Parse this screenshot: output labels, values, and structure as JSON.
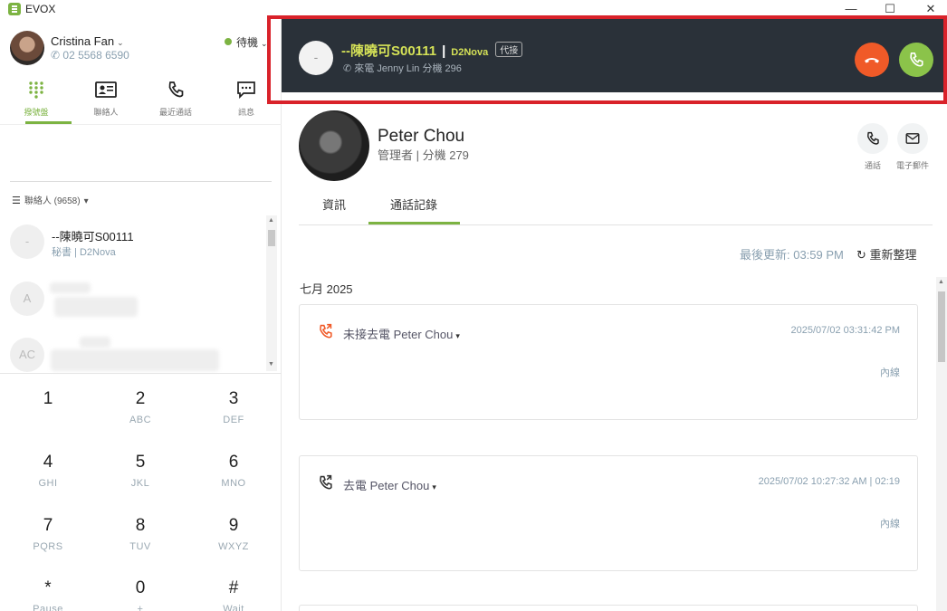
{
  "window": {
    "title": "EVOX",
    "minimize": "—",
    "maximize": "☐",
    "close": "✕"
  },
  "user": {
    "name": "Cristina Fan",
    "phone": "02 5568 6590",
    "status": "待機",
    "status_color": "#7cb342"
  },
  "nav": {
    "items": [
      {
        "label": "撥號盤",
        "icon": "dialpad-icon"
      },
      {
        "label": "聯絡人",
        "icon": "contact-card-icon"
      },
      {
        "label": "最近通話",
        "icon": "phone-icon"
      },
      {
        "label": "訊息",
        "icon": "message-icon"
      }
    ]
  },
  "contacts": {
    "header": "聯絡人 (9658)",
    "items": [
      {
        "avatar": "-",
        "name": "--陳曉可S00111",
        "sub": "秘書 | D2Nova"
      },
      {
        "avatar": "A",
        "name": "",
        "sub": ""
      },
      {
        "avatar": "AC",
        "name": "",
        "sub": ""
      }
    ]
  },
  "dialpad": [
    {
      "digit": "1",
      "letters": ""
    },
    {
      "digit": "2",
      "letters": "ABC"
    },
    {
      "digit": "3",
      "letters": "DEF"
    },
    {
      "digit": "4",
      "letters": "GHI"
    },
    {
      "digit": "5",
      "letters": "JKL"
    },
    {
      "digit": "6",
      "letters": "MNO"
    },
    {
      "digit": "7",
      "letters": "PQRS"
    },
    {
      "digit": "8",
      "letters": "TUV"
    },
    {
      "digit": "9",
      "letters": "WXYZ"
    },
    {
      "digit": "*",
      "letters": "Pause"
    },
    {
      "digit": "0",
      "letters": "+"
    },
    {
      "digit": "#",
      "letters": "Wait"
    }
  ],
  "incoming_call": {
    "avatar": "-",
    "caller": "--陳曉可S00111",
    "separator": "|",
    "company": "D2Nova",
    "tag": "代接",
    "subtitle": "來電 Jenny Lin 分機 296",
    "accent_color": "#d4e157",
    "hangup_color": "#f05a28",
    "answer_color": "#8bc34a"
  },
  "contact_detail": {
    "name": "Peter Chou",
    "role": "管理者 | 分機 279",
    "actions": {
      "call": "通話",
      "email": "電子郵件"
    },
    "tabs": [
      "資訊",
      "通話記錄"
    ],
    "active_tab": "通話記錄",
    "last_updated": "最後更新: 03:59 PM",
    "refresh": "重新整理",
    "month": "七月 2025",
    "calls": [
      {
        "title": "未接去電 Peter Chou",
        "time": "2025/07/02 03:31:42 PM",
        "type": "內線",
        "icon": "missed-outgoing-call-icon",
        "icon_color": "#f05a28"
      },
      {
        "title": "去電 Peter Chou",
        "time": "2025/07/02 10:27:32 AM | 02:19",
        "type": "內線",
        "icon": "outgoing-call-icon",
        "icon_color": "#333333"
      }
    ]
  }
}
